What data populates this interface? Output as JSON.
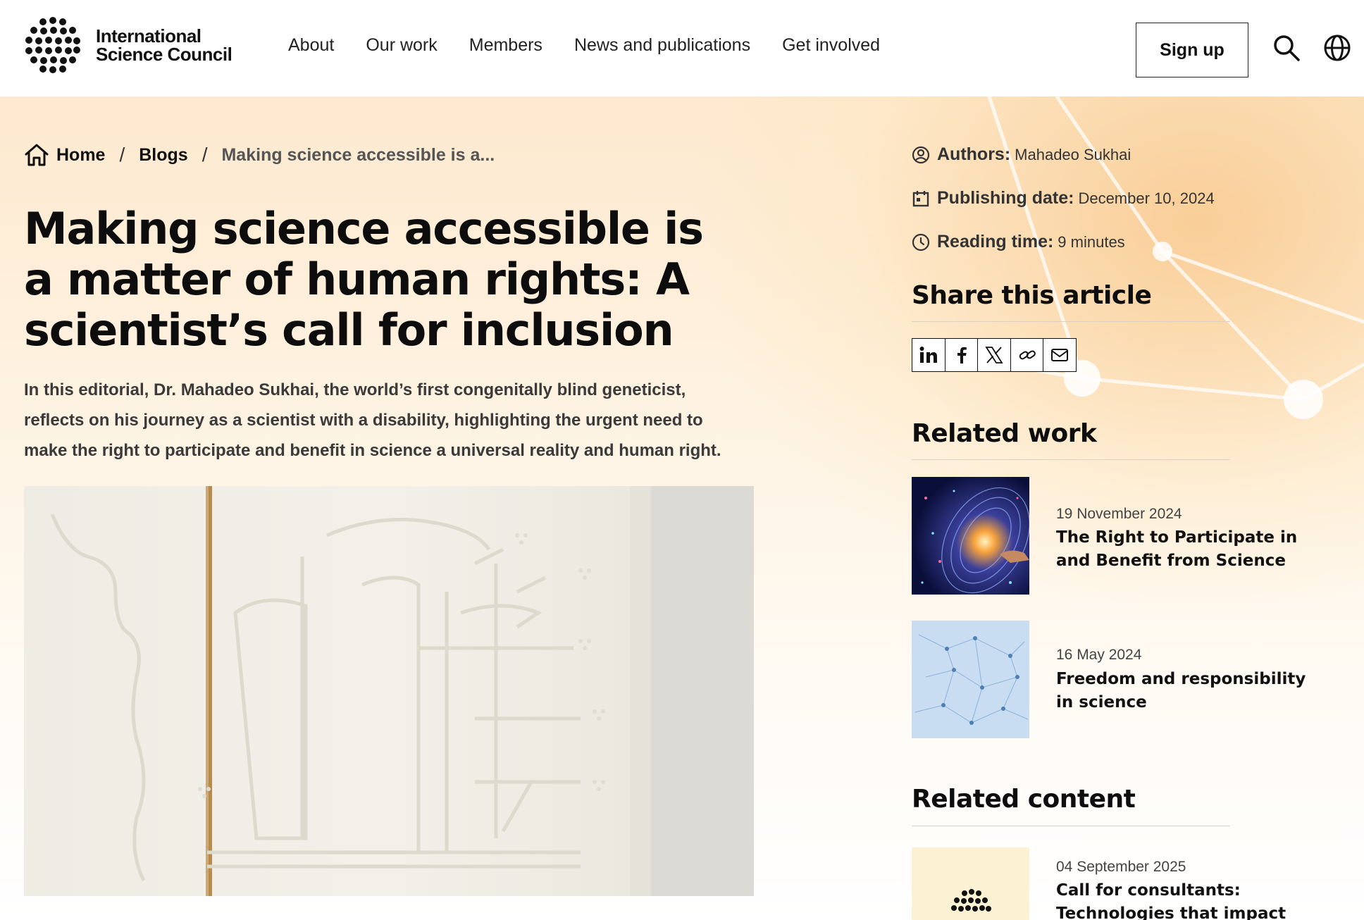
{
  "header": {
    "logo_line1": "International",
    "logo_line2": "Science Council",
    "nav": [
      "About",
      "Our work",
      "Members",
      "News and publications",
      "Get involved"
    ],
    "signup_label": "Sign up"
  },
  "breadcrumb": {
    "home": "Home",
    "sep": "/",
    "blogs": "Blogs",
    "current": "Making science accessible is a..."
  },
  "article": {
    "title": "Making science accessible is a matter of human rights: A scientist’s call for inclusion",
    "lede": "In this editorial, Dr. Mahadeo Sukhai, the world’s first congenitally blind geneticist, reflects on his journey as a scientist with a disability, highlighting the urgent need to make the right to participate and benefit in science a universal reality and human right."
  },
  "meta": {
    "authors_label": "Authors:",
    "authors_value": "Mahadeo Sukhai",
    "date_label": "Publishing date:",
    "date_value": "December 10, 2024",
    "reading_label": "Reading time:",
    "reading_value": "9 minutes"
  },
  "share": {
    "heading": "Share this article",
    "icons": [
      "linkedin-icon",
      "facebook-icon",
      "x-icon",
      "link-icon",
      "mail-icon"
    ]
  },
  "related_work": {
    "heading": "Related work",
    "items": [
      {
        "date": "19 November 2024",
        "title": "The Right to Participate in and Benefit from Science"
      },
      {
        "date": "16 May 2024",
        "title": "Freedom and responsibility in science"
      }
    ]
  },
  "related_content": {
    "heading": "Related content",
    "items": [
      {
        "date": "04 September 2025",
        "title": "Call for consultants: Technologies that impact"
      }
    ]
  },
  "colors": {
    "accent_warm": "#fde9cf",
    "text": "#111111"
  }
}
